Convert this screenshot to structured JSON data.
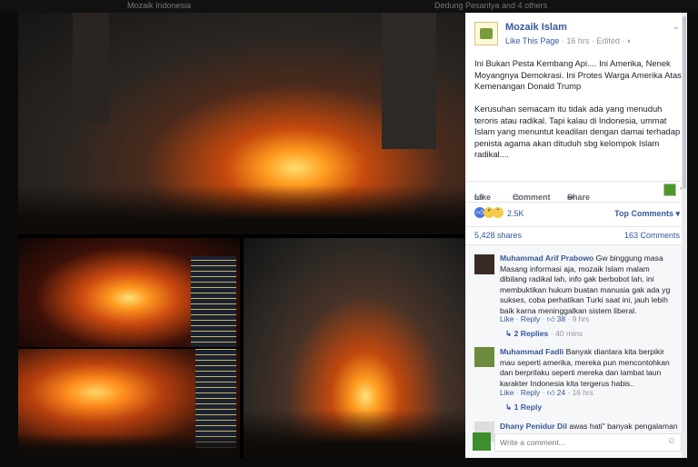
{
  "top_strip": {
    "left": "Mozaik Indonesia",
    "right": "Dedung Pesantya and 4 others"
  },
  "post": {
    "page_name": "Mozaik Islam",
    "like_page": "Like This Page",
    "meta": " · 16 hrs · Edited · ",
    "text1": "Ini Bukan Pesta Kembang Api.... Ini Amerika, Nenek Moyangnya Demokrasi. Ini Protes Warga Amerika Atas Kemenangan Donald Trump",
    "text2": "Kerusuhan semacam itu tidak ada yang menuduh teroris atau radikal. Tapi kalau di Indonesia, ummat Islam yang menuntut keadilan dengan damai terhadap penista agama akan dituduh sbg kelompok Islam radikal....",
    "actions": {
      "like": "Like",
      "comment": "Comment",
      "share": "Share"
    },
    "reactions_count": "2.5K",
    "top_comments": "Top Comments ▾",
    "shares": "5,428 shares",
    "comments_count": "163 Comments"
  },
  "comments": [
    {
      "author": "Muhammad Arif Prabowo",
      "text": " Gw binggung masa Masang informasi aja, mozaik Islam malam dibilang radikal lah, info gak berbobot lah, ini membuktikan hukum buatan manusia gak ada yg sukses, coba perhatikan Turki saat ini, jauh lebih baik karna meninggalkan sistem liberal.",
      "like": "Like",
      "reply": "Reply",
      "likes": "38",
      "time": "9 hrs",
      "replies": "2 Replies",
      "replies_time": "40 mins"
    },
    {
      "author": "Muhammad Fadli",
      "text": " Banyak diantara kita berpikir mau seperti amerika, mereka pun mencontohkan dan berprilaku seperti mereka dan lambat laun karakter Indonesia kita tergerus habis..",
      "like": "Like",
      "reply": "Reply",
      "likes": "24",
      "time": "16 hrs",
      "replies": "1 Reply"
    },
    {
      "author": "Dhany Penidur Dil",
      "text": " awas hati\" banyak pengalaman"
    }
  ],
  "write_comment_placeholder": "Write a comment...",
  "colors": {
    "link": "#365899",
    "fire": "#ff9a1e",
    "panel_bg": "#ffffff"
  }
}
